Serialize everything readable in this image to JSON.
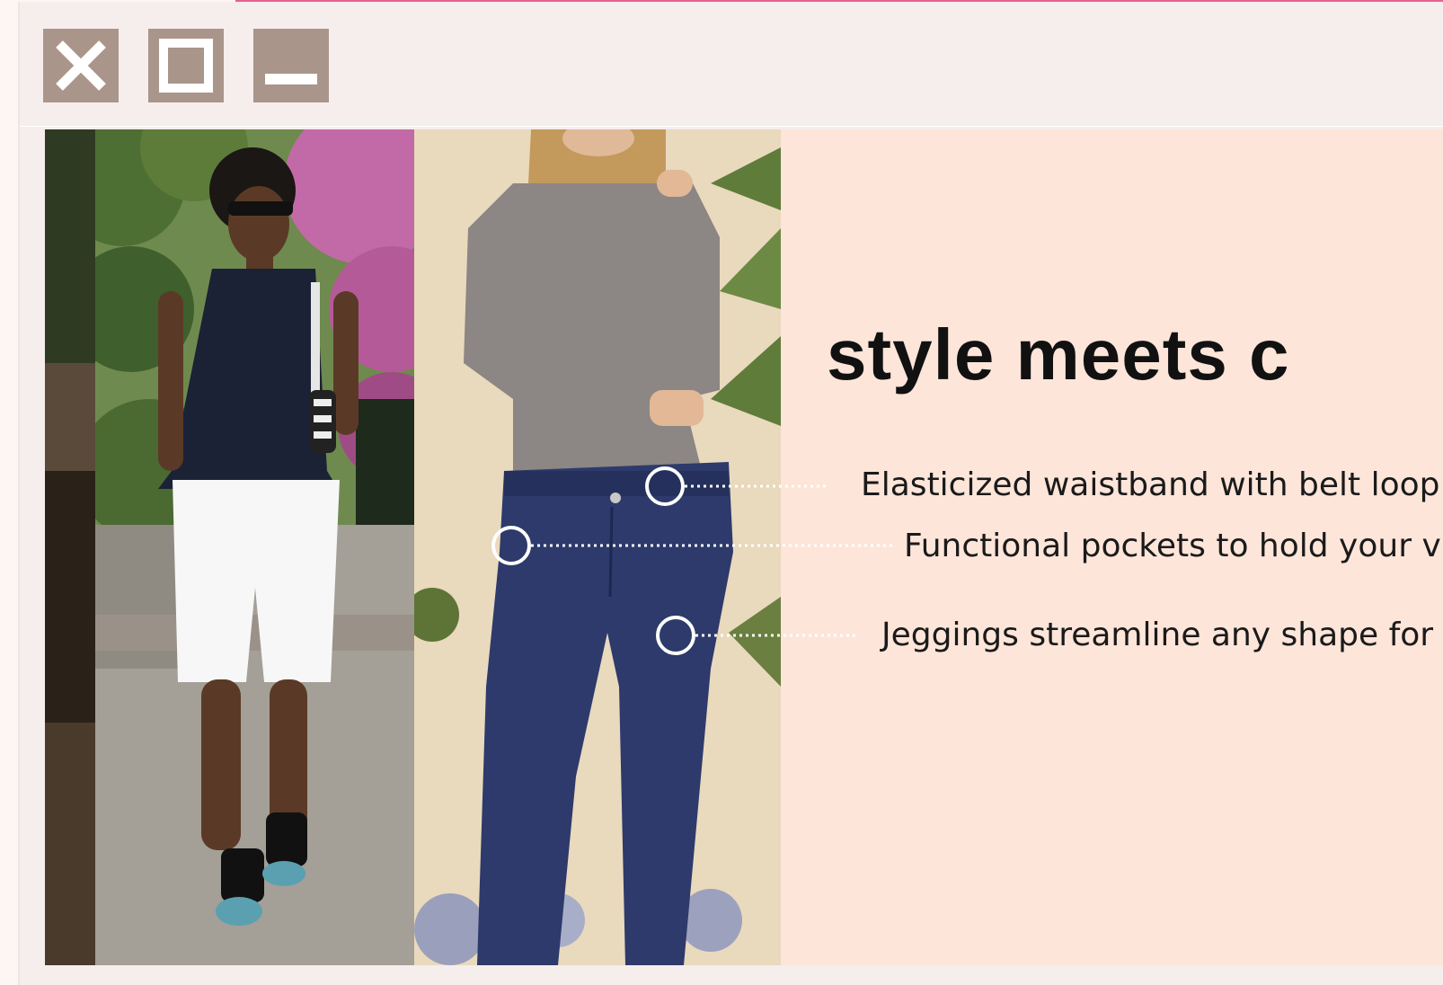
{
  "window": {
    "controls": [
      {
        "name": "close-button",
        "icon": "close-icon"
      },
      {
        "name": "maximize-button",
        "icon": "maximize-icon"
      },
      {
        "name": "minimize-button",
        "icon": "minimize-icon"
      }
    ],
    "accent_color": "#e8608f",
    "control_color": "#a9958a"
  },
  "banner": {
    "headline": "style meets c",
    "features": [
      "Elasticized waistband with belt loop",
      "Functional pockets to hold your v",
      "Jeggings streamline any shape for"
    ],
    "background_color": "#fde5d9"
  }
}
